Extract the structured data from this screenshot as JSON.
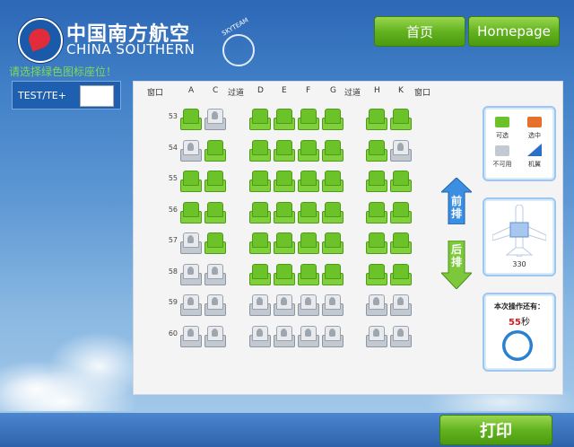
{
  "brand": {
    "cn": "中国南方航空",
    "en": "CHINA SOUTHERN",
    "alliance": "SKYTEAM"
  },
  "nav": {
    "home_cn": "首页",
    "home_en": "Homepage"
  },
  "hint": "请选择绿色图标座位！",
  "passenger": {
    "name": "TEST/TE+",
    "seat_value": ""
  },
  "columns": {
    "window_left": "窗口",
    "a": "A",
    "c": "C",
    "aisle_left": "过道",
    "d": "D",
    "e": "E",
    "f": "F",
    "g": "G",
    "aisle_right": "过道",
    "h": "H",
    "k": "K",
    "window_right": "窗口"
  },
  "rows": [
    {
      "num": "53",
      "seats": [
        "a",
        "o",
        "a",
        "a",
        "a",
        "a",
        "a",
        "a"
      ]
    },
    {
      "num": "54",
      "seats": [
        "o",
        "a",
        "a",
        "a",
        "a",
        "a",
        "a",
        "o"
      ]
    },
    {
      "num": "55",
      "seats": [
        "a",
        "a",
        "a",
        "a",
        "a",
        "a",
        "a",
        "a"
      ]
    },
    {
      "num": "56",
      "seats": [
        "a",
        "a",
        "a",
        "a",
        "a",
        "a",
        "a",
        "a"
      ]
    },
    {
      "num": "57",
      "seats": [
        "o",
        "a",
        "a",
        "a",
        "a",
        "a",
        "a",
        "a"
      ]
    },
    {
      "num": "58",
      "seats": [
        "o",
        "o",
        "a",
        "a",
        "a",
        "a",
        "a",
        "a"
      ]
    },
    {
      "num": "59",
      "seats": [
        "o",
        "o",
        "o",
        "o",
        "o",
        "o",
        "o",
        "o"
      ]
    },
    {
      "num": "60",
      "seats": [
        "o",
        "o",
        "o",
        "o",
        "o",
        "o",
        "o",
        "o"
      ]
    }
  ],
  "legend": {
    "available": "可选",
    "selected": "选中",
    "unavailable": "不可用",
    "wing": "机翼",
    "colors": {
      "available": "#6cc229",
      "selected": "#e5702a",
      "unavailable": "#c3c9d0",
      "wing": "#2b6fc6"
    }
  },
  "arrows": {
    "front_1": "前",
    "front_2": "排",
    "back_1": "后",
    "back_2": "排"
  },
  "aircraft": {
    "model": "330"
  },
  "timer": {
    "title": "本次操作还有：",
    "seconds": "55",
    "unit": "秒"
  },
  "print_label": "打印"
}
